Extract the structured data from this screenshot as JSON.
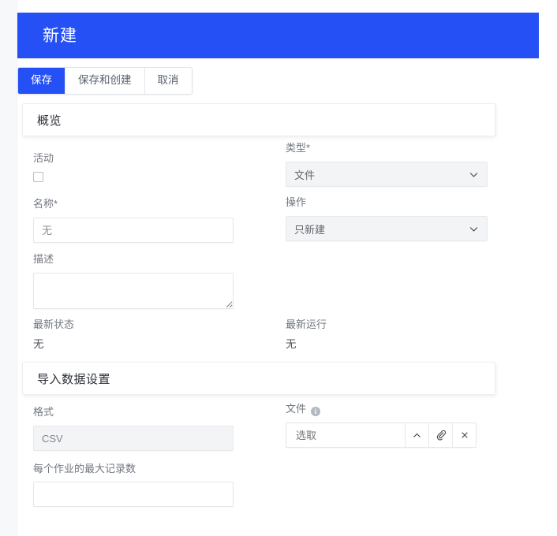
{
  "header": {
    "title": "新建",
    "accent_color": "#2450f6"
  },
  "toolbar": {
    "buttons": [
      {
        "label": "保存",
        "style": "primary"
      },
      {
        "label": "保存和创建",
        "style": "default"
      },
      {
        "label": "取消",
        "style": "default"
      }
    ]
  },
  "sections": {
    "overview": {
      "title": "概览",
      "fields": {
        "active": {
          "label": "活动",
          "checked": false
        },
        "type": {
          "label": "类型*",
          "value": "文件",
          "icon": "chevron-down-icon"
        },
        "name": {
          "label": "名称*",
          "value": "",
          "placeholder": "无"
        },
        "operation": {
          "label": "操作",
          "value": "只新建",
          "icon": "chevron-down-icon"
        },
        "description": {
          "label": "描述",
          "value": "",
          "placeholder": ""
        },
        "latest_status": {
          "label": "最新状态",
          "value": "无"
        },
        "latest_run": {
          "label": "最新运行",
          "value": "无"
        }
      }
    },
    "import_settings": {
      "title": "导入数据设置",
      "fields": {
        "format": {
          "label": "格式",
          "value": "CSV",
          "disabled": true
        },
        "file": {
          "label": "文件",
          "info_icon": "info-icon",
          "value": "",
          "placeholder": "选取",
          "buttons": [
            {
              "name": "caret-up-icon",
              "glyph": "^"
            },
            {
              "name": "paperclip-icon",
              "glyph": "paperclip"
            },
            {
              "name": "clear-icon",
              "glyph": "×"
            }
          ]
        },
        "max_records": {
          "label": "每个作业的最大记录数",
          "value": "",
          "placeholder": ""
        }
      }
    }
  }
}
